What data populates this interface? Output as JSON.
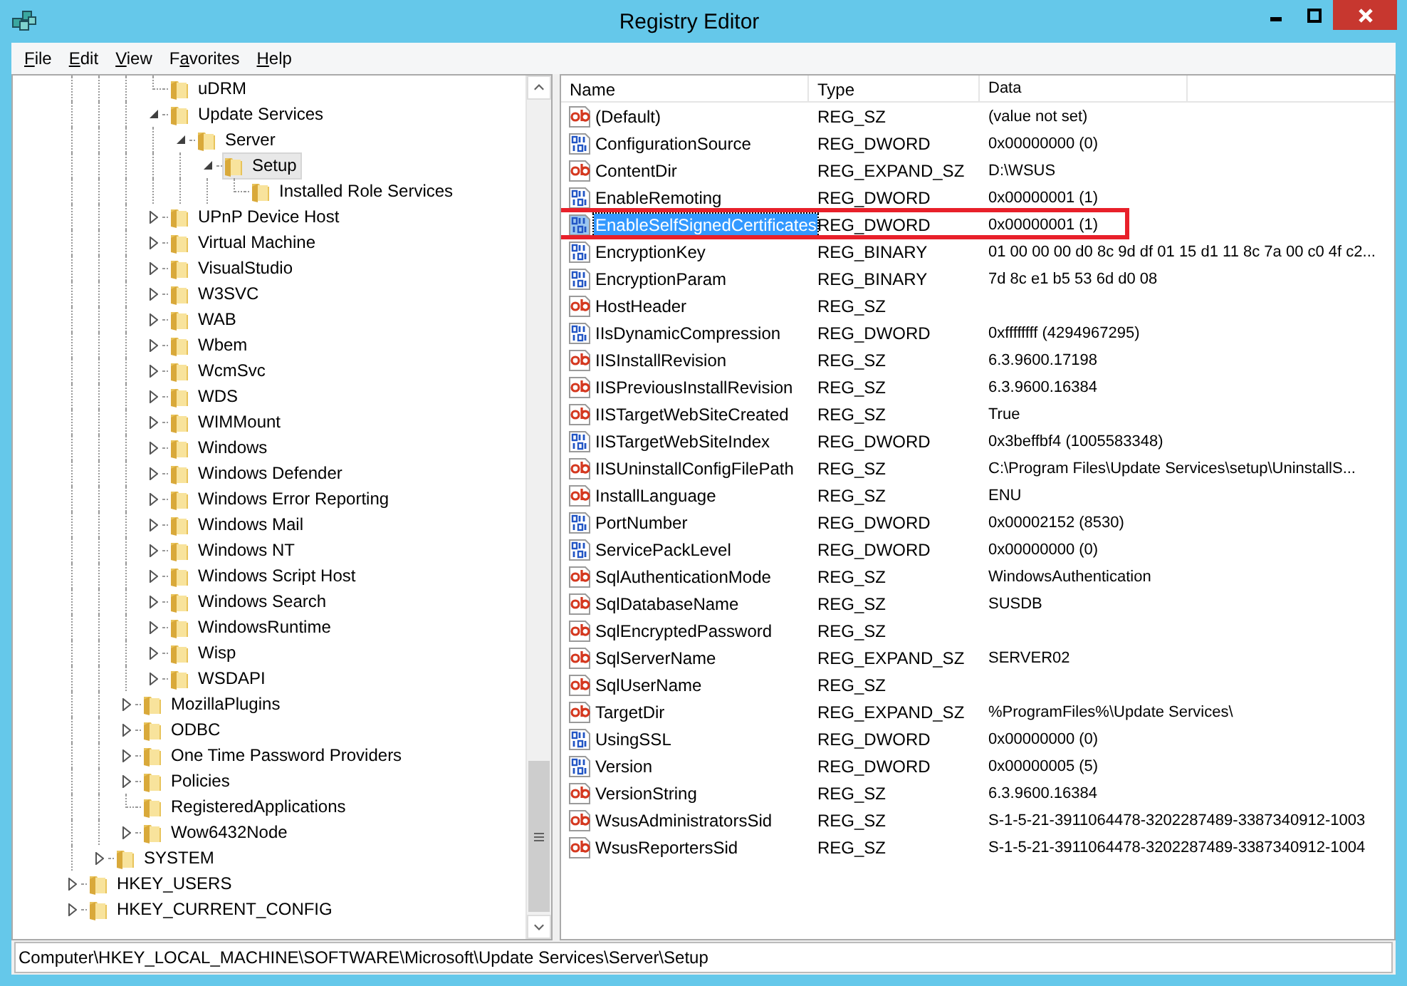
{
  "window": {
    "title": "Registry Editor"
  },
  "menu": [
    {
      "key": "F",
      "post": "ile"
    },
    {
      "key": "E",
      "post": "dit"
    },
    {
      "key": "V",
      "post": "iew"
    },
    {
      "pre": "F",
      "key": "a",
      "post": "vorites"
    },
    {
      "key": "H",
      "post": "elp"
    }
  ],
  "tree": {
    "children": [
      {
        "children": [
          {
            "children": [
              {
                "children": [
                  {
                    "label": "uDRM",
                    "selected": false
                  },
                  {
                    "label": "Update Services",
                    "expanded": true,
                    "selected": false,
                    "children": [
                      {
                        "label": "Server",
                        "expanded": true,
                        "selected": false,
                        "children": [
                          {
                            "label": "Setup",
                            "expanded": true,
                            "selected": true,
                            "children": [
                              {
                                "label": "Installed Role Services",
                                "selected": false
                              }
                            ]
                          }
                        ]
                      }
                    ]
                  },
                  {
                    "label": "UPnP Device Host",
                    "expanded": false,
                    "selected": false
                  },
                  {
                    "label": "Virtual Machine",
                    "expanded": false,
                    "selected": false
                  },
                  {
                    "label": "VisualStudio",
                    "expanded": false,
                    "selected": false
                  },
                  {
                    "label": "W3SVC",
                    "expanded": false,
                    "selected": false
                  },
                  {
                    "label": "WAB",
                    "expanded": false,
                    "selected": false
                  },
                  {
                    "label": "Wbem",
                    "expanded": false,
                    "selected": false
                  },
                  {
                    "label": "WcmSvc",
                    "expanded": false,
                    "selected": false
                  },
                  {
                    "label": "WDS",
                    "expanded": false,
                    "selected": false
                  },
                  {
                    "label": "WIMMount",
                    "expanded": false,
                    "selected": false
                  },
                  {
                    "label": "Windows",
                    "expanded": false,
                    "selected": false
                  },
                  {
                    "label": "Windows Defender",
                    "expanded": false,
                    "selected": false
                  },
                  {
                    "label": "Windows Error Reporting",
                    "expanded": false,
                    "selected": false
                  },
                  {
                    "label": "Windows Mail",
                    "expanded": false,
                    "selected": false
                  },
                  {
                    "label": "Windows NT",
                    "expanded": false,
                    "selected": false
                  },
                  {
                    "label": "Windows Script Host",
                    "expanded": false,
                    "selected": false
                  },
                  {
                    "label": "Windows Search",
                    "expanded": false,
                    "selected": false
                  },
                  {
                    "label": "WindowsRuntime",
                    "expanded": false,
                    "selected": false
                  },
                  {
                    "label": "Wisp",
                    "expanded": false,
                    "selected": false
                  },
                  {
                    "label": "WSDAPI",
                    "expanded": false,
                    "selected": false
                  }
                ]
              },
              {
                "label": "MozillaPlugins",
                "expanded": false,
                "selected": false
              },
              {
                "label": "ODBC",
                "expanded": false,
                "selected": false
              },
              {
                "label": "One Time Password Providers",
                "expanded": false,
                "selected": false
              },
              {
                "label": "Policies",
                "expanded": false,
                "selected": false
              },
              {
                "label": "RegisteredApplications",
                "selected": false
              },
              {
                "label": "Wow6432Node",
                "expanded": false,
                "selected": false
              }
            ]
          },
          {
            "label": "SYSTEM",
            "expanded": false,
            "selected": false
          }
        ]
      },
      {
        "label": "HKEY_USERS",
        "expanded": false,
        "selected": false
      },
      {
        "label": "HKEY_CURRENT_CONFIG",
        "expanded": false,
        "selected": false
      }
    ]
  },
  "values": {
    "columns": [
      "Name",
      "Type",
      "Data"
    ],
    "rows": [
      {
        "kind": "string",
        "name": "(Default)",
        "type": "REG_SZ",
        "data": "(value not set)",
        "selected": false,
        "outlined": false
      },
      {
        "kind": "binary",
        "name": "ConfigurationSource",
        "type": "REG_DWORD",
        "data": "0x00000000 (0)",
        "selected": false,
        "outlined": false
      },
      {
        "kind": "string",
        "name": "ContentDir",
        "type": "REG_EXPAND_SZ",
        "data": "D:\\WSUS",
        "selected": false,
        "outlined": false
      },
      {
        "kind": "binary",
        "name": "EnableRemoting",
        "type": "REG_DWORD",
        "data": "0x00000001 (1)",
        "selected": false,
        "outlined": false
      },
      {
        "kind": "binary",
        "name": "EnableSelfSignedCertificates",
        "type": "REG_DWORD",
        "data": "0x00000001 (1)",
        "selected": true,
        "outlined": true
      },
      {
        "kind": "binary",
        "name": "EncryptionKey",
        "type": "REG_BINARY",
        "data": "01 00 00 00 d0 8c 9d df 01 15 d1 11 8c 7a 00 c0 4f c2...",
        "selected": false,
        "outlined": false
      },
      {
        "kind": "binary",
        "name": "EncryptionParam",
        "type": "REG_BINARY",
        "data": "7d 8c e1 b5 53 6d d0 08",
        "selected": false,
        "outlined": false
      },
      {
        "kind": "string",
        "name": "HostHeader",
        "type": "REG_SZ",
        "selected": false,
        "outlined": false
      },
      {
        "kind": "binary",
        "name": "IIsDynamicCompression",
        "type": "REG_DWORD",
        "data": "0xffffffff (4294967295)",
        "selected": false,
        "outlined": false
      },
      {
        "kind": "string",
        "name": "IISInstallRevision",
        "type": "REG_SZ",
        "data": "6.3.9600.17198",
        "selected": false,
        "outlined": false
      },
      {
        "kind": "string",
        "name": "IISPreviousInstallRevision",
        "type": "REG_SZ",
        "data": "6.3.9600.16384",
        "selected": false,
        "outlined": false
      },
      {
        "kind": "string",
        "name": "IISTargetWebSiteCreated",
        "type": "REG_SZ",
        "data": "True",
        "selected": false,
        "outlined": false
      },
      {
        "kind": "binary",
        "name": "IISTargetWebSiteIndex",
        "type": "REG_DWORD",
        "data": "0x3beffbf4 (1005583348)",
        "selected": false,
        "outlined": false
      },
      {
        "kind": "string",
        "name": "IISUninstallConfigFilePath",
        "type": "REG_SZ",
        "data": "C:\\Program Files\\Update Services\\setup\\UninstallS...",
        "selected": false,
        "outlined": false
      },
      {
        "kind": "string",
        "name": "InstallLanguage",
        "type": "REG_SZ",
        "data": "ENU",
        "selected": false,
        "outlined": false
      },
      {
        "kind": "binary",
        "name": "PortNumber",
        "type": "REG_DWORD",
        "data": "0x00002152 (8530)",
        "selected": false,
        "outlined": false
      },
      {
        "kind": "binary",
        "name": "ServicePackLevel",
        "type": "REG_DWORD",
        "data": "0x00000000 (0)",
        "selected": false,
        "outlined": false
      },
      {
        "kind": "string",
        "name": "SqlAuthenticationMode",
        "type": "REG_SZ",
        "data": "WindowsAuthentication",
        "selected": false,
        "outlined": false
      },
      {
        "kind": "string",
        "name": "SqlDatabaseName",
        "type": "REG_SZ",
        "data": "SUSDB",
        "selected": false,
        "outlined": false
      },
      {
        "kind": "string",
        "name": "SqlEncryptedPassword",
        "type": "REG_SZ",
        "selected": false,
        "outlined": false
      },
      {
        "kind": "string",
        "name": "SqlServerName",
        "type": "REG_EXPAND_SZ",
        "data": "SERVER02",
        "selected": false,
        "outlined": false
      },
      {
        "kind": "string",
        "name": "SqlUserName",
        "type": "REG_SZ",
        "selected": false,
        "outlined": false
      },
      {
        "kind": "string",
        "name": "TargetDir",
        "type": "REG_EXPAND_SZ",
        "data": "%ProgramFiles%\\Update Services\\",
        "selected": false,
        "outlined": false
      },
      {
        "kind": "binary",
        "name": "UsingSSL",
        "type": "REG_DWORD",
        "data": "0x00000000 (0)",
        "selected": false,
        "outlined": false
      },
      {
        "kind": "binary",
        "name": "Version",
        "type": "REG_DWORD",
        "data": "0x00000005 (5)",
        "selected": false,
        "outlined": false
      },
      {
        "kind": "string",
        "name": "VersionString",
        "type": "REG_SZ",
        "data": "6.3.9600.16384",
        "selected": false,
        "outlined": false
      },
      {
        "kind": "string",
        "name": "WsusAdministratorsSid",
        "type": "REG_SZ",
        "data": "S-1-5-21-3911064478-3202287489-3387340912-1003",
        "selected": false,
        "outlined": false
      },
      {
        "kind": "string",
        "name": "WsusReportersSid",
        "type": "REG_SZ",
        "data": "S-1-5-21-3911064478-3202287489-3387340912-1004",
        "selected": false,
        "outlined": false
      }
    ]
  },
  "status_bar": "Computer\\HKEY_LOCAL_MACHINE\\SOFTWARE\\Microsoft\\Update Services\\Server\\Setup"
}
